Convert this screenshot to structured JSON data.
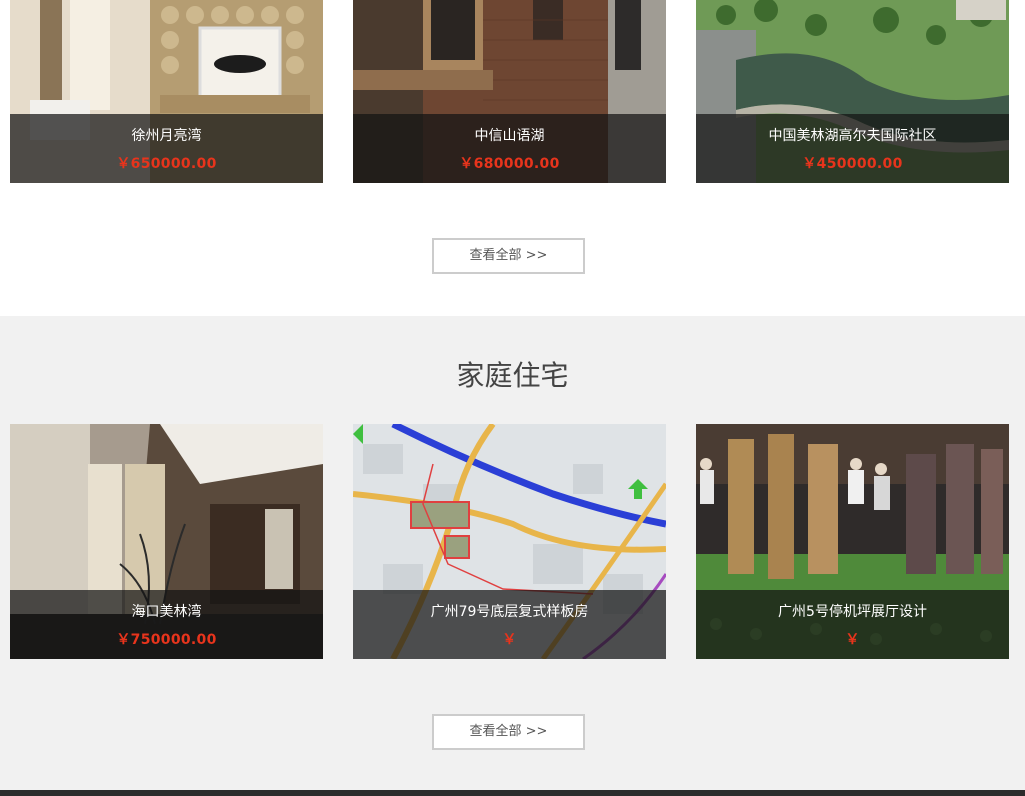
{
  "colors": {
    "price": "#e8341c",
    "section_bg": "#f1f1f1",
    "caption_bg": "#141414"
  },
  "section1": {
    "cards": [
      {
        "name": "徐州月亮湾",
        "price": "￥650000.00",
        "image": "luxury-interior-photo"
      },
      {
        "name": "中信山语湖",
        "price": "￥680000.00",
        "image": "brick-villa-photo"
      },
      {
        "name": "中国美林湖高尔夫国际社区",
        "price": "￥450000.00",
        "image": "aerial-lake-community-photo"
      }
    ],
    "more_label": "查看全部 >>"
  },
  "section2": {
    "title": "家庭住宅",
    "cards": [
      {
        "name": "海口美林湾",
        "price": "￥750000.00",
        "image": "modern-interior-photo"
      },
      {
        "name": "广州79号底层复式样板房",
        "price": "￥",
        "image": "street-map-image"
      },
      {
        "name": "广州5号停机坪展厅设计",
        "price": "￥",
        "image": "sales-center-model-photo"
      }
    ],
    "more_label": "查看全部 >>"
  }
}
